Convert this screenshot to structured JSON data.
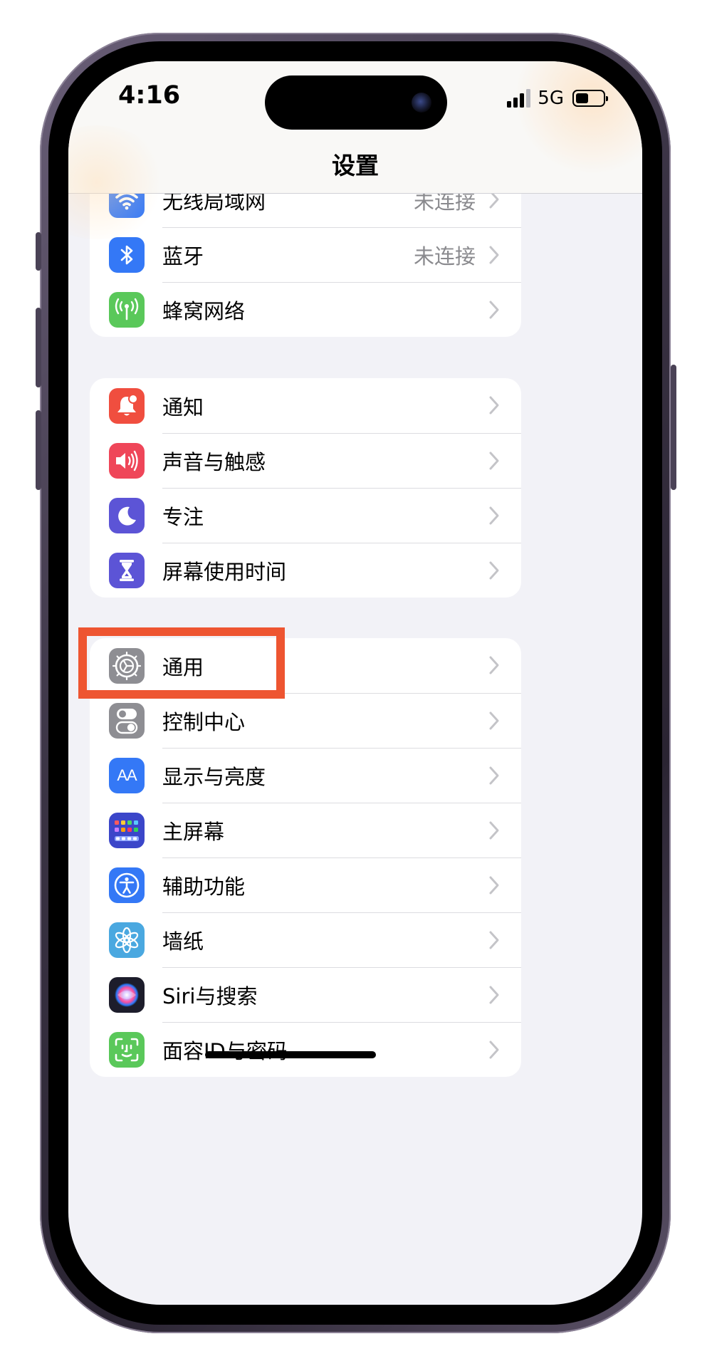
{
  "status_bar": {
    "time": "4:16",
    "network": "5G"
  },
  "header": {
    "title": "设置"
  },
  "groups": [
    {
      "rows": [
        {
          "id": "wifi",
          "label": "无线局域网",
          "detail": "未连接",
          "icon": "wifi-icon",
          "color": "#3478f6"
        },
        {
          "id": "bluetooth",
          "label": "蓝牙",
          "detail": "未连接",
          "icon": "bluetooth-icon",
          "color": "#3478f6"
        },
        {
          "id": "cellular",
          "label": "蜂窝网络",
          "detail": "",
          "icon": "antenna-icon",
          "color": "#5ac85a"
        }
      ]
    },
    {
      "rows": [
        {
          "id": "notifications",
          "label": "通知",
          "icon": "bell-icon",
          "color": "#f04e3f"
        },
        {
          "id": "sounds",
          "label": "声音与触感",
          "icon": "speaker-icon",
          "color": "#ef4659"
        },
        {
          "id": "focus",
          "label": "专注",
          "icon": "moon-icon",
          "color": "#5c54d6"
        },
        {
          "id": "screen-time",
          "label": "屏幕使用时间",
          "icon": "hourglass-icon",
          "color": "#5c54d6"
        }
      ]
    },
    {
      "rows": [
        {
          "id": "general",
          "label": "通用",
          "icon": "gear-icon",
          "color": "#8e8e93"
        },
        {
          "id": "control-center",
          "label": "控制中心",
          "icon": "toggles-icon",
          "color": "#8e8e93"
        },
        {
          "id": "display",
          "label": "显示与亮度",
          "icon": "text-size-icon",
          "color": "#3478f6",
          "icon_text": "AA"
        },
        {
          "id": "home-screen",
          "label": "主屏幕",
          "icon": "app-grid-icon",
          "color": "#3b46c9"
        },
        {
          "id": "accessibility",
          "label": "辅助功能",
          "icon": "accessibility-icon",
          "color": "#3478f6"
        },
        {
          "id": "wallpaper",
          "label": "墙纸",
          "icon": "flower-icon",
          "color": "#4aa8e0"
        },
        {
          "id": "siri",
          "label": "Siri与搜索",
          "icon": "siri-icon",
          "color": "#1d1d2b"
        },
        {
          "id": "face-id",
          "label": "面容ID与密码",
          "icon": "face-id-icon",
          "color": "#5ac85a"
        }
      ]
    }
  ],
  "highlight": {
    "target": "general",
    "color": "#ee5531"
  }
}
